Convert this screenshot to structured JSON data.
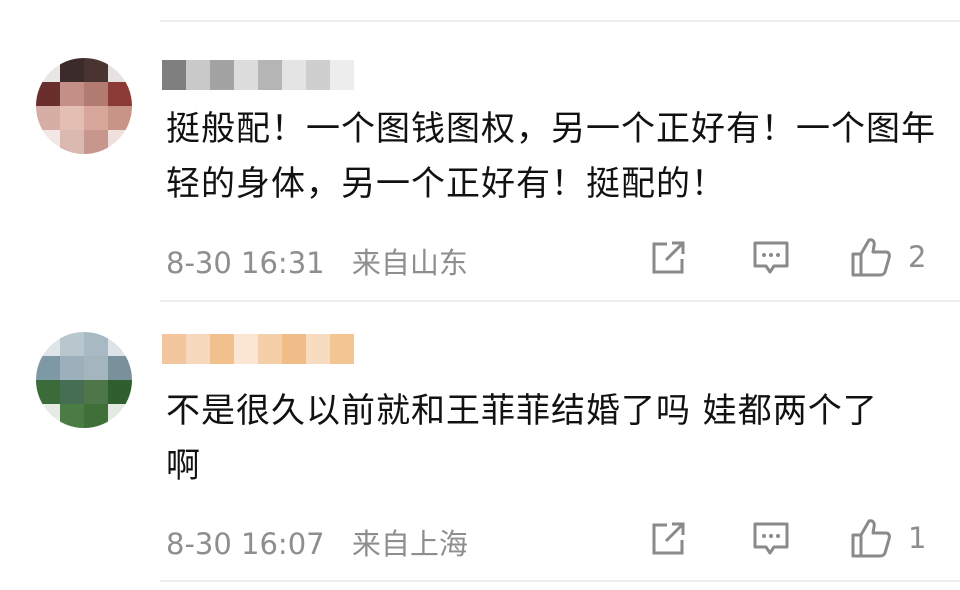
{
  "comments": [
    {
      "text": "挺般配！一个图钱图权，另一个正好有！一个图年轻的身体，另一个正好有！挺配的！",
      "time": "8-30 16:31",
      "location": "来自山东",
      "likes": "2",
      "icons": [
        "share-icon",
        "comment-icon",
        "like-icon"
      ]
    },
    {
      "text": "不是很久以前就和王菲菲结婚了吗 娃都两个了啊",
      "time": "8-30 16:07",
      "location": "来自上海",
      "likes": "1",
      "icons": [
        "share-icon",
        "comment-icon",
        "like-icon"
      ]
    }
  ]
}
